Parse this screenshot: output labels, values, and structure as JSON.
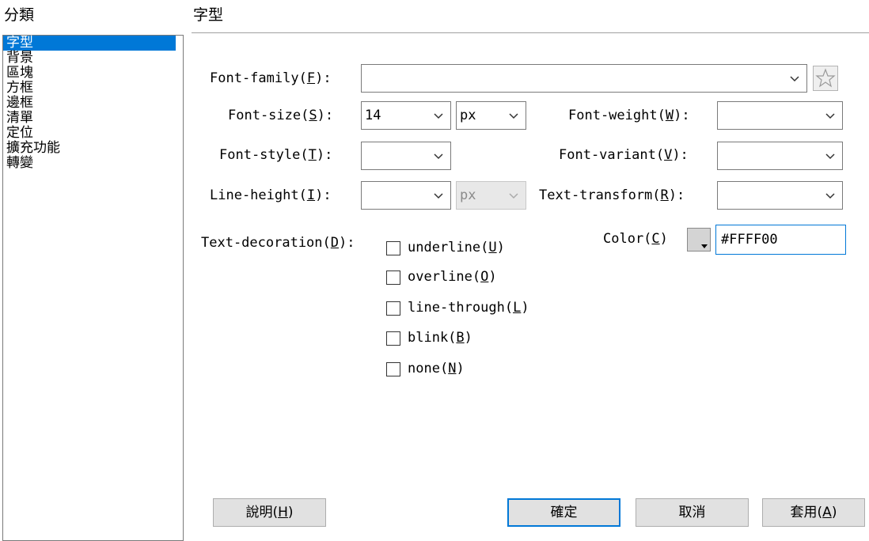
{
  "category_panel": {
    "title": "分類",
    "items": [
      "字型",
      "背景",
      "區塊",
      "方框",
      "邊框",
      "清單",
      "定位",
      "擴充功能",
      "轉變"
    ],
    "selected": "字型"
  },
  "section": {
    "title": "字型"
  },
  "font_family": {
    "label": "Font-family(",
    "key": "F",
    "suffix": "):",
    "value": ""
  },
  "font_size": {
    "label": "Font-size(",
    "key": "S",
    "suffix": "):",
    "value": "14",
    "unit": "px"
  },
  "font_weight": {
    "label": "Font-weight(",
    "key": "W",
    "suffix": "):",
    "value": ""
  },
  "font_style": {
    "label": "Font-style(",
    "key": "T",
    "suffix": "):",
    "value": ""
  },
  "font_variant": {
    "label": "Font-variant(",
    "key": "V",
    "suffix": "):",
    "value": ""
  },
  "line_height": {
    "label": "Line-height(",
    "key": "I",
    "suffix": "):",
    "value": "",
    "unit": "px"
  },
  "text_transform": {
    "label": "Text-transform(",
    "key": "R",
    "suffix": "):",
    "value": ""
  },
  "text_decoration": {
    "label": "Text-decoration(",
    "key": "D",
    "suffix": "):",
    "options": [
      {
        "label": "underline(",
        "key": "U",
        "suffix": ")",
        "checked": false
      },
      {
        "label": "overline(",
        "key": "O",
        "suffix": ")",
        "checked": false
      },
      {
        "label": "line-through(",
        "key": "L",
        "suffix": ")",
        "checked": false
      },
      {
        "label": "blink(",
        "key": "B",
        "suffix": ")",
        "checked": false
      },
      {
        "label": "none(",
        "key": "N",
        "suffix": ")",
        "checked": false
      }
    ]
  },
  "color": {
    "label": "Color(",
    "key": "C",
    "suffix": ")",
    "value": "#FFFF00"
  },
  "buttons": {
    "help": {
      "label": "說明(",
      "key": "H",
      "suffix": ")"
    },
    "ok": "確定",
    "cancel": "取消",
    "apply": {
      "label": "套用(",
      "key": "A",
      "suffix": ")"
    }
  },
  "icons": {
    "dropdown": "chevron-down-icon",
    "favorite": "star-icon",
    "color_picker": "color-swatch-icon"
  },
  "colors": {
    "accent": "#0078d7",
    "selection_text": "#ffffff"
  }
}
